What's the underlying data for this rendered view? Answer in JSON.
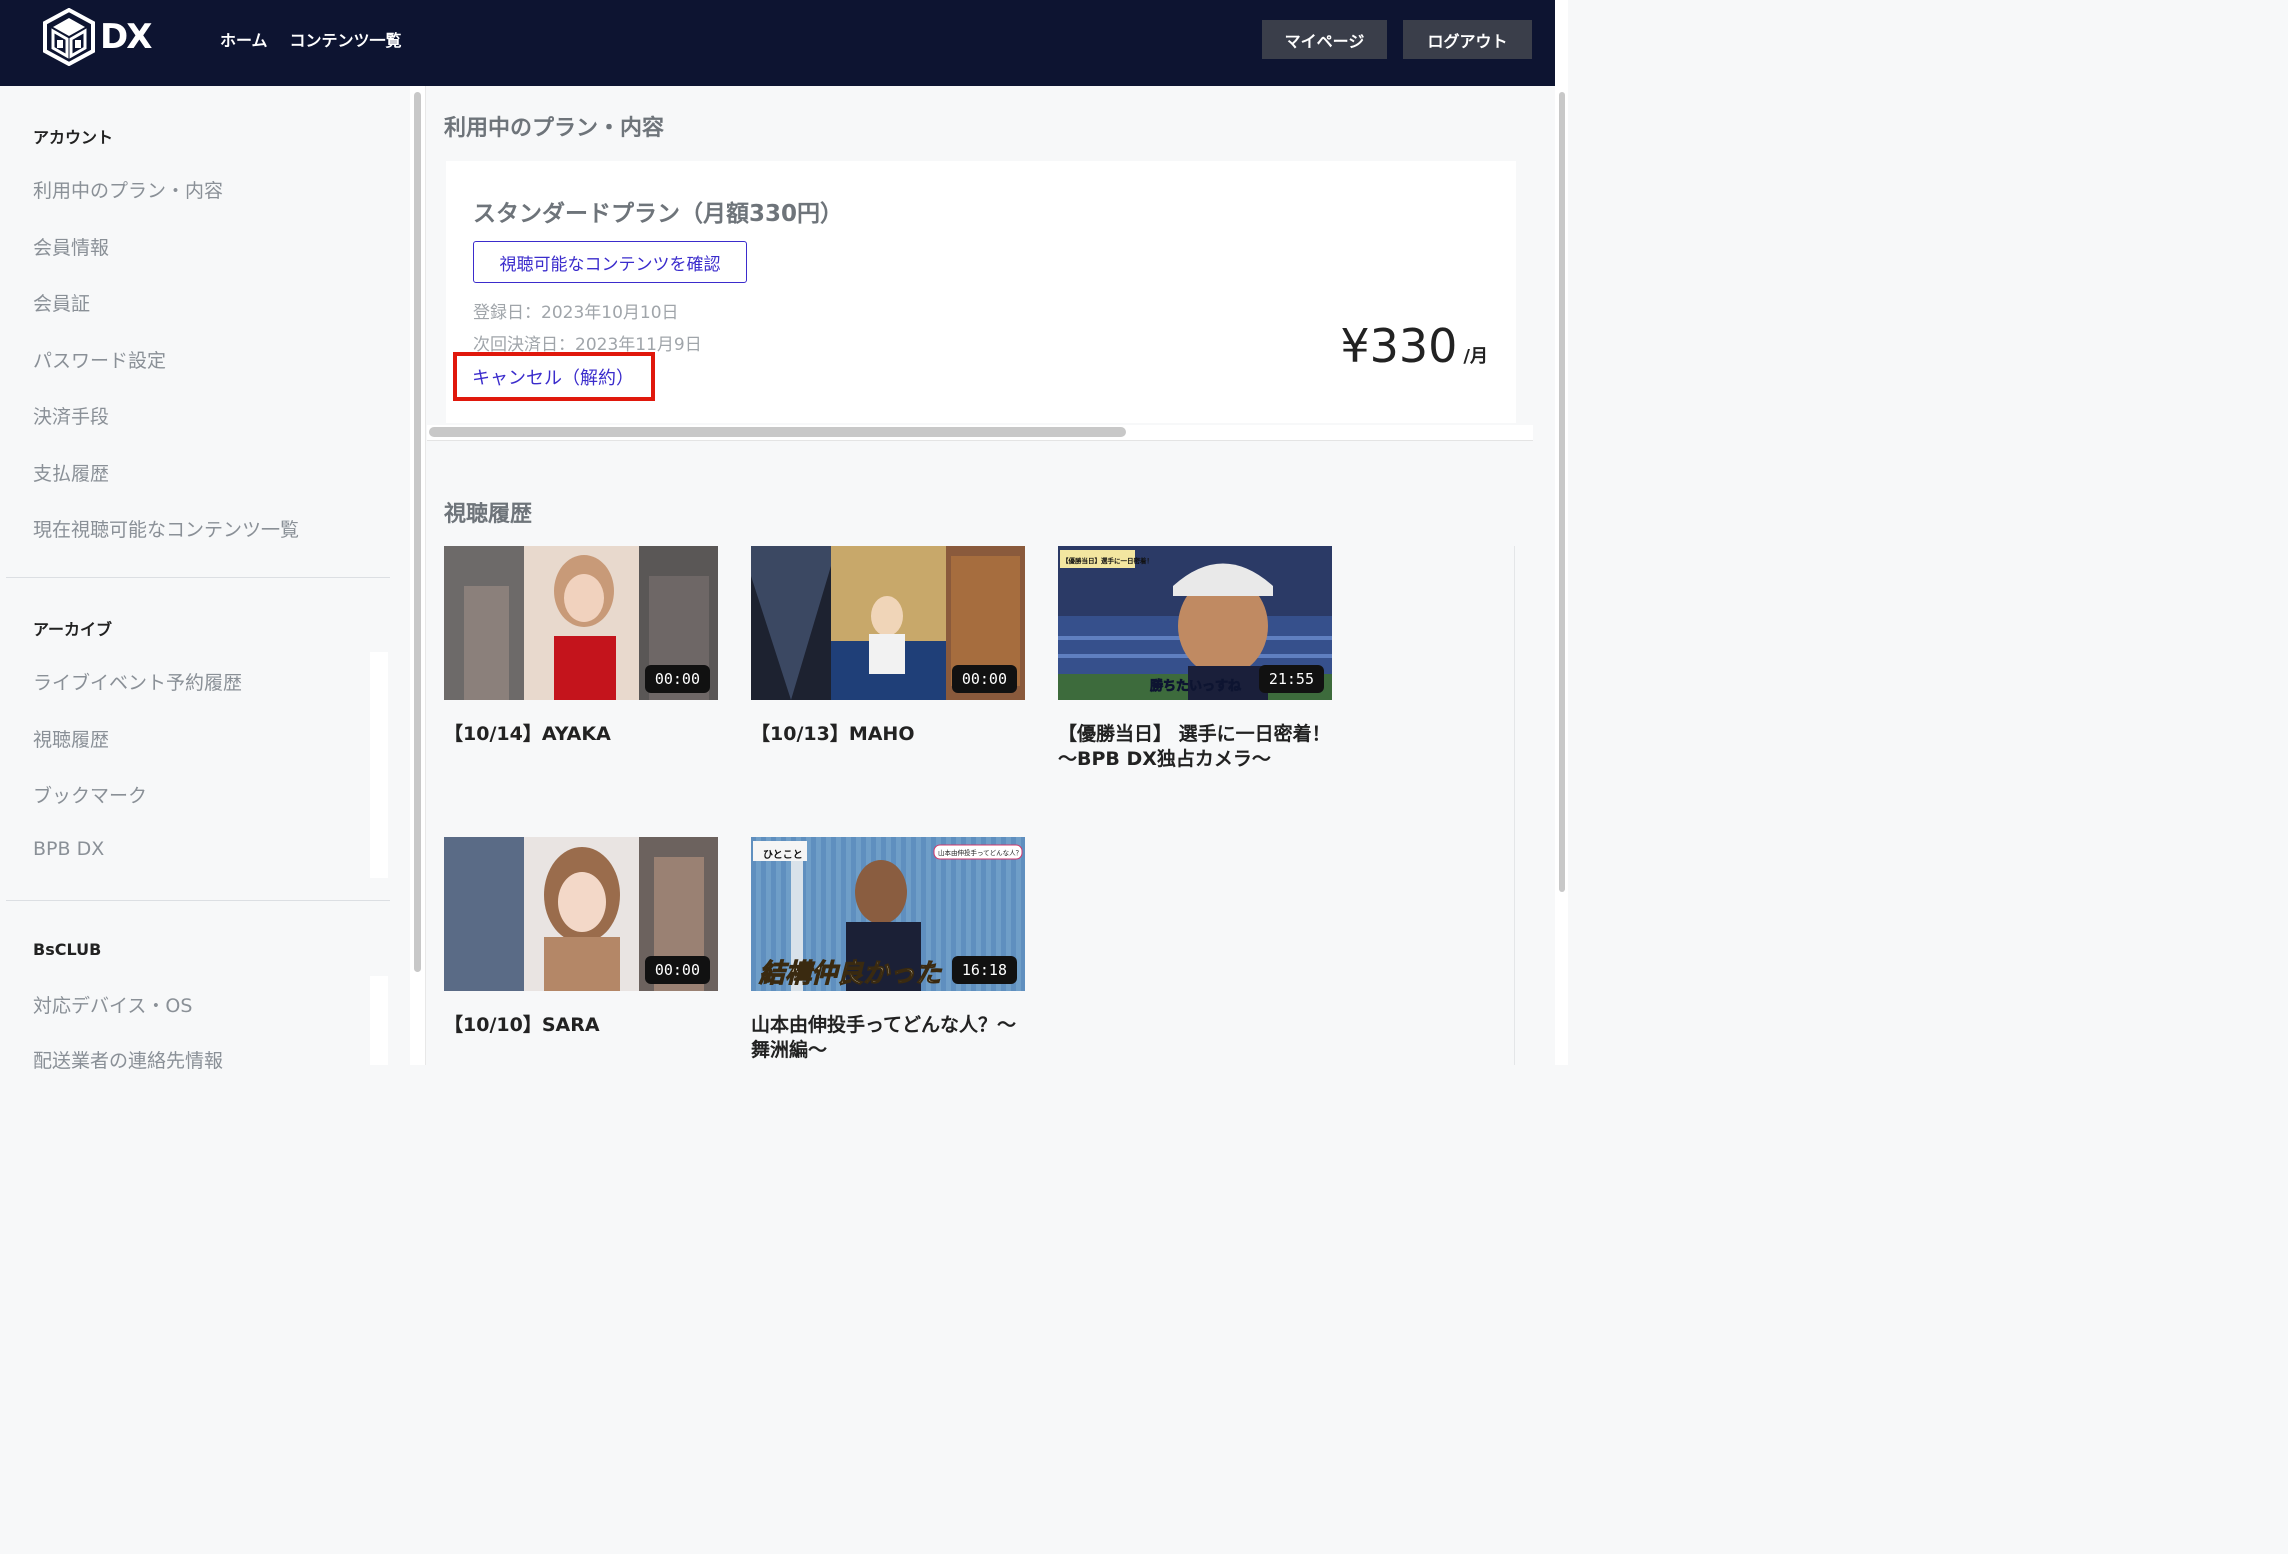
{
  "header": {
    "logo_text": "DX",
    "nav": [
      "ホーム",
      "コンテンツ一覧"
    ],
    "mypage_label": "マイページ",
    "logout_label": "ログアウト"
  },
  "sidebar": {
    "account_title": "アカウント",
    "account_items": [
      "利用中のプラン・内容",
      "会員情報",
      "会員証",
      "パスワード設定",
      "決済手段",
      "支払履歴",
      "現在視聴可能なコンテンツ一覧"
    ],
    "archive_title": "アーカイブ",
    "archive_items": [
      "ライブイベント予約履歴",
      "視聴履歴",
      "ブックマーク",
      "BPB DX"
    ],
    "club_title": "BsCLUB",
    "club_items": [
      "対応デバイス・OS",
      "配送業者の連絡先情報"
    ]
  },
  "plan": {
    "section_title": "利用中のプラン・内容",
    "name": "スタンダードプラン（月額330円）",
    "contents_button": "視聴可能なコンテンツを確認",
    "registered": "登録日：2023年10月10日",
    "next_payment": "次回決済日：2023年11月9日",
    "cancel_label": "キャンセル（解約）",
    "price": "¥330",
    "price_unit": "/月"
  },
  "history": {
    "title": "視聴履歴",
    "videos": [
      {
        "title": "【10/14】AYAKA",
        "duration": "00:00"
      },
      {
        "title": "【10/13】MAHO",
        "duration": "00:00"
      },
      {
        "title": "【優勝当日】 選手に一日密着！～BPB DX独占カメラ～",
        "duration": "21:55",
        "caption": "勝ちたいっすね",
        "badge": "【優勝当日】選手に一日密着！"
      },
      {
        "title": "【10/10】SARA",
        "duration": "00:00"
      },
      {
        "title": "山本由伸投手ってどんな人？～舞洲編～",
        "duration": "16:18",
        "caption": "結構仲良かった",
        "badge": "山本由伸投手ってどんな人？",
        "corner": "ひとこと"
      }
    ]
  },
  "colors": {
    "header_bg": "#0d1431",
    "accent": "#3b2ccc",
    "highlight": "#e0180c"
  }
}
